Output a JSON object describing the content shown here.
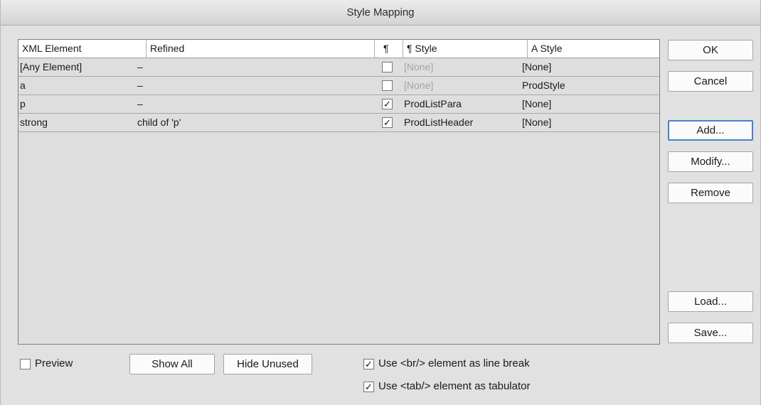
{
  "window": {
    "title": "Style Mapping"
  },
  "table": {
    "headers": {
      "xml_element": "XML Element",
      "refined": "Refined",
      "para_toggle": "¶",
      "para_style": "¶  Style",
      "char_style": "A  Style"
    },
    "rows": [
      {
        "element": "[Any Element]",
        "refined": "–",
        "para_checked": false,
        "para_style": "[None]",
        "char_style": "[None]"
      },
      {
        "element": "a",
        "refined": "–",
        "para_checked": false,
        "para_style": "[None]",
        "char_style": "ProdStyle"
      },
      {
        "element": "p",
        "refined": "–",
        "para_checked": true,
        "para_style": "ProdListPara",
        "char_style": "[None]"
      },
      {
        "element": "strong",
        "refined": "child of 'p'",
        "para_checked": true,
        "para_style": "ProdListHeader",
        "char_style": "[None]"
      }
    ]
  },
  "buttons": {
    "ok": "OK",
    "cancel": "Cancel",
    "add": "Add...",
    "modify": "Modify...",
    "remove": "Remove",
    "load": "Load...",
    "save": "Save...",
    "show_all": "Show All",
    "hide_unused": "Hide Unused"
  },
  "options": {
    "preview": {
      "label": "Preview",
      "checked": false
    },
    "br_line_break": {
      "label": "Use <br/> element as line break",
      "checked": true
    },
    "tab_tabulator": {
      "label": "Use <tab/> element as tabulator",
      "checked": true
    }
  },
  "glyphs": {
    "check": "✓"
  }
}
